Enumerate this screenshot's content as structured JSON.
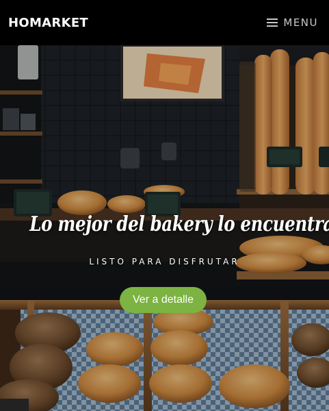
{
  "navbar": {
    "brand": "HOMARKET",
    "menu_label": "MENU"
  },
  "hero": {
    "title": "Lo mejor del bakery lo encuentras aquí",
    "subtitle": "LISTO PARA DISFRUTAR",
    "cta_label": "Ver a detalle"
  },
  "colors": {
    "navbar_bg": "#000000",
    "accent": "#7cb342",
    "text": "#ffffff",
    "menu_text": "#c8c8c8"
  },
  "icons": {
    "menu": "hamburger-icon"
  }
}
